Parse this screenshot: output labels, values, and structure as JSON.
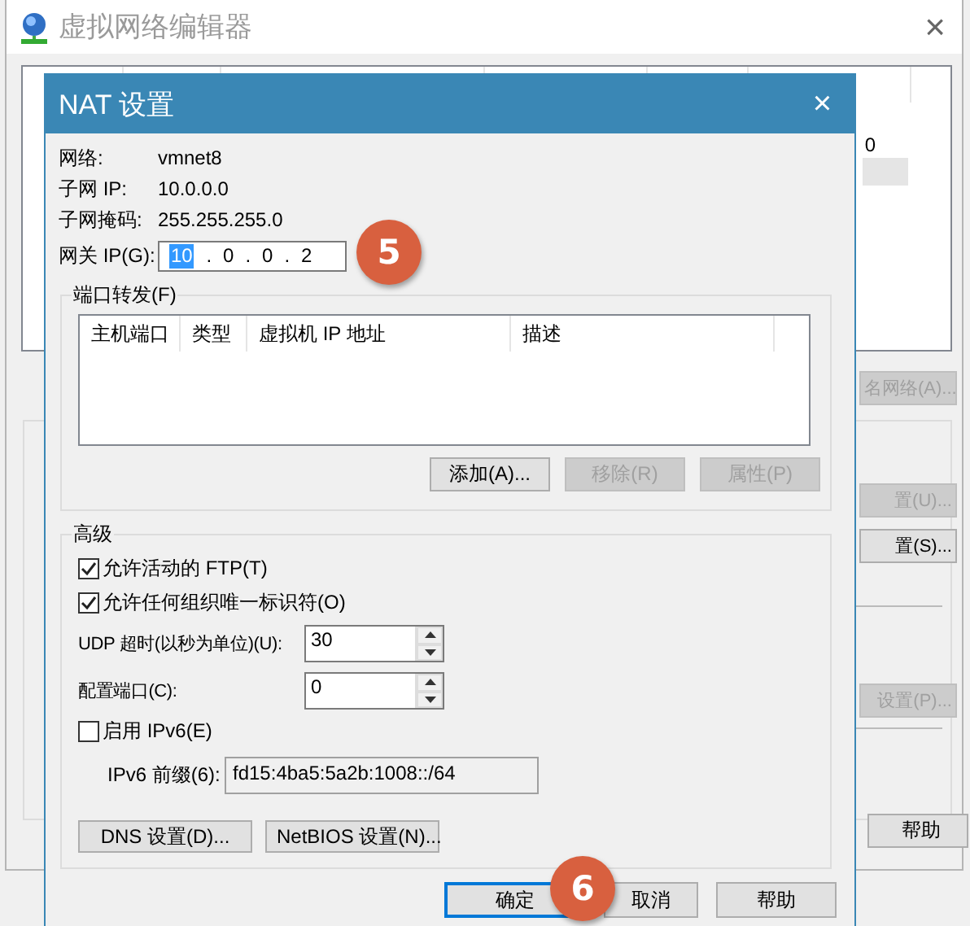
{
  "background_window": {
    "title": "虚拟网络编辑器",
    "close": "×",
    "list": {
      "cell_fragment": "0"
    },
    "side_buttons": [
      {
        "label": "名网络(A)...",
        "disabled": true
      },
      {
        "label": "置(U)...",
        "disabled": true
      },
      {
        "label": "置(S)...",
        "disabled": false
      },
      {
        "label": "设置(P)...",
        "disabled": true
      }
    ],
    "footer_buttons": [
      {
        "label": "帮助",
        "disabled": false
      }
    ]
  },
  "nat_dialog": {
    "title": "NAT 设置",
    "close": "×",
    "info": [
      {
        "label": "网络:",
        "value": "vmnet8"
      },
      {
        "label": "子网 IP:",
        "value": "10.0.0.0"
      },
      {
        "label": "子网掩码:",
        "value": "255.255.255.0"
      }
    ],
    "gateway": {
      "label": "网关 IP(G):",
      "octets": [
        {
          "value": "10",
          "selected": true
        },
        {
          "value": "0",
          "selected": false
        },
        {
          "value": "0",
          "selected": false
        },
        {
          "value": "2",
          "selected": false
        }
      ],
      "separators": [
        ".",
        ".",
        "."
      ]
    },
    "port_forwarding": {
      "title": "端口转发(F)",
      "columns": [
        "主机端口",
        "类型",
        "虚拟机 IP 地址",
        "描述"
      ],
      "buttons": [
        {
          "label": "添加(A)...",
          "disabled": false
        },
        {
          "label": "移除(R)",
          "disabled": true
        },
        {
          "label": "属性(P)",
          "disabled": true
        }
      ]
    },
    "advanced": {
      "title": "高级",
      "checkboxes": [
        {
          "label": "允许活动的 FTP(T)",
          "checked": true
        },
        {
          "label": "允许任何组织唯一标识符(O)",
          "checked": true
        }
      ],
      "spinners": [
        {
          "label": "UDP 超时(以秒为单位)(U):",
          "value": "30"
        },
        {
          "label": "配置端口(C):",
          "value": "0"
        }
      ],
      "ipv6": {
        "label": "启用 IPv6(E)",
        "checked": false
      },
      "ipv6_prefix": {
        "label": "IPv6 前缀(6):",
        "value": "fd15:4ba5:5a2b:1008::/64",
        "disabled": true
      },
      "buttons": [
        "DNS 设置(D)...",
        "NetBIOS 设置(N)..."
      ]
    },
    "footer_buttons": [
      {
        "label": "确定",
        "default": true
      },
      {
        "label": "取消",
        "default": false
      },
      {
        "label": "帮助",
        "default": false
      }
    ]
  },
  "step_badges": [
    {
      "label": "5"
    },
    {
      "label": "6"
    }
  ]
}
